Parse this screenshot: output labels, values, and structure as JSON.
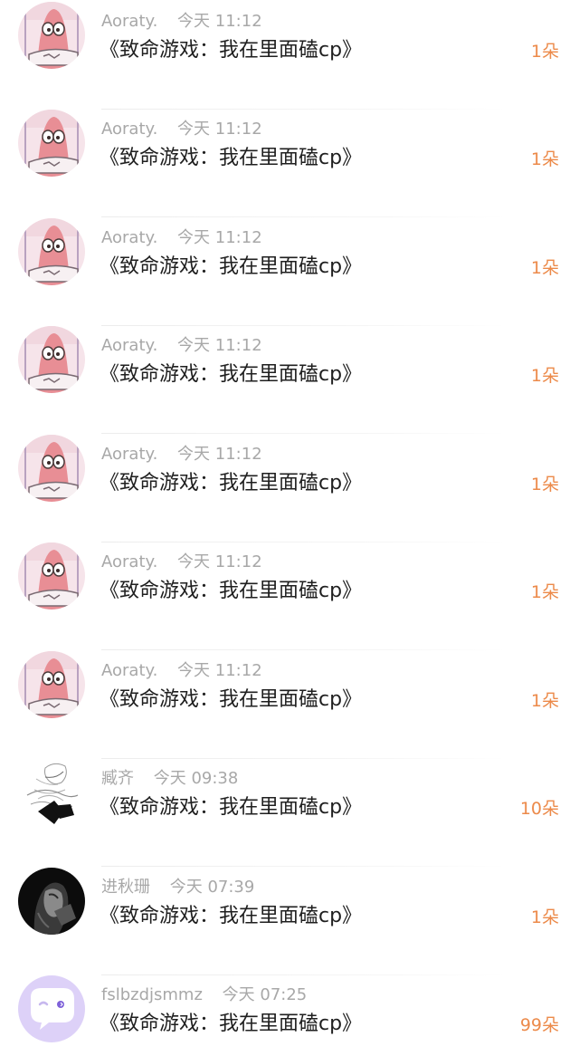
{
  "items": [
    {
      "name": "Aoraty.",
      "time": "今天 11:12",
      "title": "《致命游戏：我在里面磕cp》",
      "count": "1朵",
      "avatar": "patrick-avatar"
    },
    {
      "name": "Aoraty.",
      "time": "今天 11:12",
      "title": "《致命游戏：我在里面磕cp》",
      "count": "1朵",
      "avatar": "patrick-avatar"
    },
    {
      "name": "Aoraty.",
      "time": "今天 11:12",
      "title": "《致命游戏：我在里面磕cp》",
      "count": "1朵",
      "avatar": "patrick-avatar"
    },
    {
      "name": "Aoraty.",
      "time": "今天 11:12",
      "title": "《致命游戏：我在里面磕cp》",
      "count": "1朵",
      "avatar": "patrick-avatar"
    },
    {
      "name": "Aoraty.",
      "time": "今天 11:12",
      "title": "《致命游戏：我在里面磕cp》",
      "count": "1朵",
      "avatar": "patrick-avatar"
    },
    {
      "name": "Aoraty.",
      "time": "今天 11:12",
      "title": "《致命游戏：我在里面磕cp》",
      "count": "1朵",
      "avatar": "patrick-avatar"
    },
    {
      "name": "Aoraty.",
      "time": "今天 11:12",
      "title": "《致命游戏：我在里面磕cp》",
      "count": "1朵",
      "avatar": "patrick-avatar"
    },
    {
      "name": "臧齐",
      "time": "今天 09:38",
      "title": "《致命游戏：我在里面磕cp》",
      "count": "10朵",
      "avatar": "sketch-avatar"
    },
    {
      "name": "进秋珊",
      "time": "今天 07:39",
      "title": "《致命游戏：我在里面磕cp》",
      "count": "1朵",
      "avatar": "dark-portrait-avatar"
    },
    {
      "name": "fslbzdjsmmz",
      "time": "今天 07:25",
      "title": "《致命游戏：我在里面磕cp》",
      "count": "99朵",
      "avatar": "chat-bubble-avatar"
    }
  ],
  "colors": {
    "count": "#ec8a4a",
    "meta": "#a8a8a8",
    "title": "#1f1f1f",
    "patrick_pink": "#e88e95",
    "patrick_bg": "#f6e4ea",
    "bubble_bg": "#ddd1f8"
  }
}
